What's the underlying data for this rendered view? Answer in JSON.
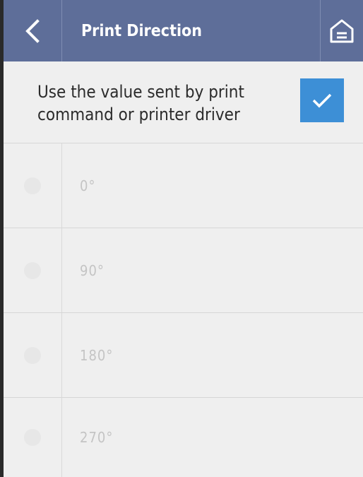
{
  "header": {
    "title": "Print Direction",
    "back_icon": "chevron-left-icon",
    "home_icon": "home-icon"
  },
  "setting": {
    "label": "Use the value sent by print command or printer driver",
    "checked": true
  },
  "options": [
    {
      "label": "0°",
      "selected": false,
      "enabled": false
    },
    {
      "label": "90°",
      "selected": false,
      "enabled": false
    },
    {
      "label": "180°",
      "selected": false,
      "enabled": false
    },
    {
      "label": "270°",
      "selected": false,
      "enabled": false
    }
  ],
  "colors": {
    "header_bg": "#5e6e99",
    "accent": "#3d8fd6",
    "background": "#efefef",
    "disabled_text": "#c4c4c4"
  }
}
